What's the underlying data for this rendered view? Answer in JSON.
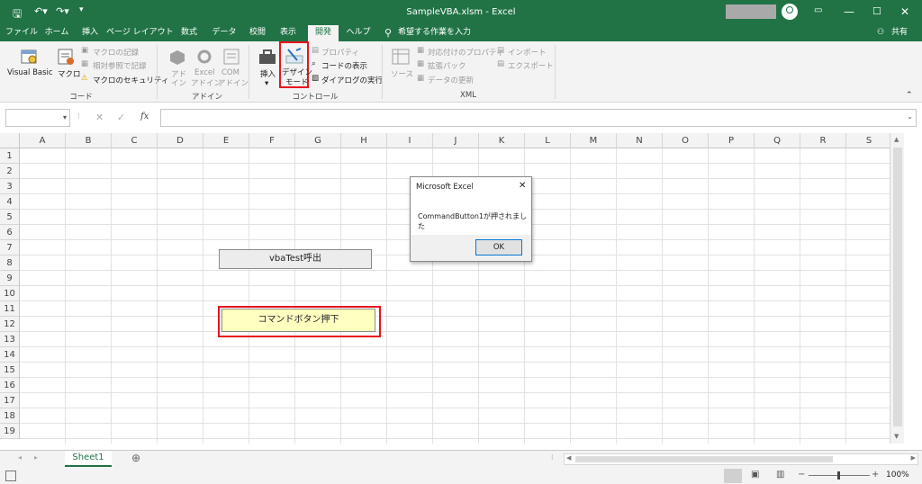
{
  "window": {
    "title": "SampleVBA.xlsm  -  Excel"
  },
  "tabs": [
    "ファイル",
    "ホーム",
    "挿入",
    "ページ レイアウト",
    "数式",
    "データ",
    "校閲",
    "表示",
    "開発",
    "ヘルプ"
  ],
  "tell_me": "希望する作業を入力",
  "share": "共有",
  "ribbon": {
    "code": {
      "visual_basic": "Visual Basic",
      "macro": "マクロ",
      "record_macro": "マクロの記録",
      "relative_ref": "相対参照で記録",
      "macro_security": "マクロのセキュリティ",
      "group": "コード"
    },
    "addin": {
      "addin1": "アド",
      "addin2": "イン",
      "excel1": "Excel",
      "excel2": "アドイン",
      "com1": "COM",
      "com2": "アドイン",
      "group": "アドイン"
    },
    "controls": {
      "insert": "挿入",
      "design1": "デザイン",
      "design2": "モード",
      "properties": "プロパティ",
      "view_code": "コードの表示",
      "run_dialog": "ダイアログの実行",
      "group": "コントロール"
    },
    "xml": {
      "source": "ソース",
      "map_props": "対応付けのプロパティ",
      "expansion": "拡張パック",
      "refresh": "データの更新",
      "import": "インポート",
      "export": "エクスポート",
      "group": "XML"
    }
  },
  "formula_bar": {
    "name_box": "",
    "fx": "fx",
    "formula": ""
  },
  "columns": [
    "A",
    "B",
    "C",
    "D",
    "E",
    "F",
    "G",
    "H",
    "I",
    "J",
    "K",
    "L",
    "M",
    "N",
    "O",
    "P",
    "Q",
    "R",
    "S"
  ],
  "rows": [
    "1",
    "2",
    "3",
    "4",
    "5",
    "6",
    "7",
    "8",
    "9",
    "10",
    "11",
    "12",
    "13",
    "14",
    "15",
    "16",
    "17",
    "18",
    "19"
  ],
  "buttons": {
    "vba_test": "vbaTest呼出",
    "command": "コマンドボタン押下"
  },
  "dialog": {
    "title": "Microsoft Excel",
    "message": "CommandButton1が押されました",
    "ok": "OK"
  },
  "sheet": {
    "name": "Sheet1"
  },
  "status": {
    "zoom": "100%"
  },
  "colors": {
    "excel_green": "#217346",
    "highlight_red": "#e8141e",
    "command_button_bg": "#ffffc0"
  }
}
